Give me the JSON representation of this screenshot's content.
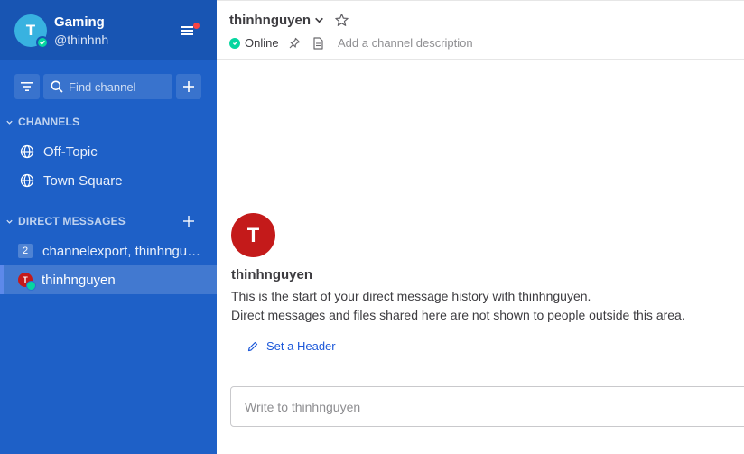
{
  "team": {
    "initial": "T",
    "name": "Gaming",
    "handle": "@thinhnh"
  },
  "search": {
    "placeholder": "Find channel"
  },
  "sections": {
    "channels_title": "CHANNELS",
    "dm_title": "DIRECT MESSAGES"
  },
  "channels": [
    {
      "label": "Off-Topic",
      "icon": "globe-icon"
    },
    {
      "label": "Town Square",
      "icon": "globe-icon"
    }
  ],
  "direct_messages": [
    {
      "badge": "2",
      "label": "channelexport, thinhnguyen"
    },
    {
      "initial": "T",
      "label": "thinhnguyen",
      "active": true
    }
  ],
  "header": {
    "channel_name": "thinhnguyen",
    "status": "Online",
    "description_placeholder": "Add a channel description"
  },
  "intro": {
    "initial": "T",
    "name": "thinhnguyen",
    "line1": "This is the start of your direct message history with thinhnguyen.",
    "line2": "Direct messages and files shared here are not shown to people outside this area.",
    "set_header": "Set a Header"
  },
  "composer": {
    "placeholder": "Write to thinhnguyen"
  },
  "colors": {
    "sidebar": "#1e60c7",
    "sidebar_header": "#1855b3",
    "online": "#06d6a0",
    "avatar_red": "#c41a1a",
    "link": "#1c58d9"
  }
}
